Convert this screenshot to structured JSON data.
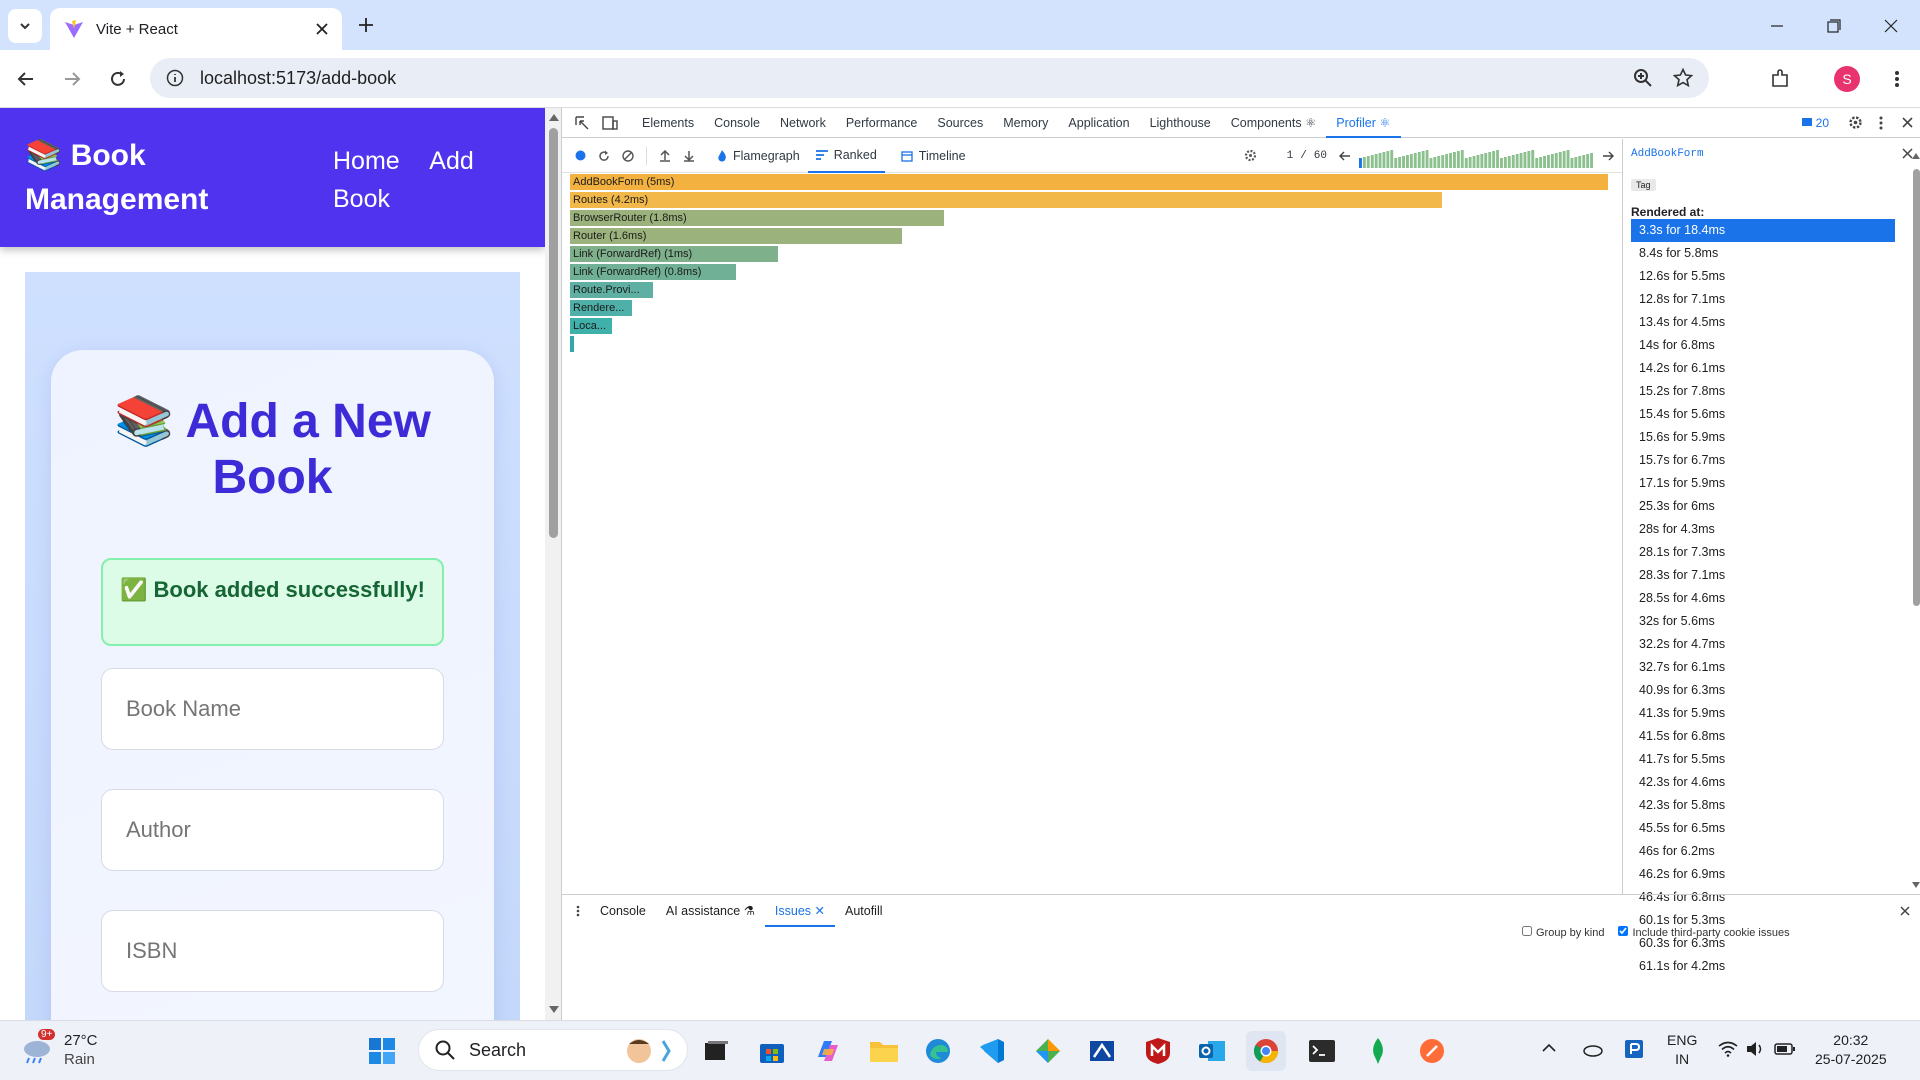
{
  "browser": {
    "tab_title": "Vite + React",
    "url": "localhost:5173/add-book",
    "profile_initial": "S",
    "accent": "#1a73e8"
  },
  "app": {
    "brand": "📚 Book Management",
    "nav_home": "Home",
    "nav_add": "Add Book",
    "card_title": "📚 Add a New Book",
    "alert": "✅ Book added successfully!",
    "placeholders": {
      "book_name": "Book Name",
      "author": "Author",
      "isbn": "ISBN"
    },
    "navbar_color": "#4f33ef"
  },
  "devtools": {
    "tabs": [
      "Elements",
      "Console",
      "Network",
      "Performance",
      "Sources",
      "Memory",
      "Application",
      "Lighthouse",
      "Components ⚛",
      "Profiler ⚛"
    ],
    "active_tab": "Profiler ⚛",
    "issues_count": "20",
    "profiler": {
      "flamegraph": "Flamegraph",
      "ranked": "Ranked",
      "timeline": "Timeline",
      "commit_index": "1",
      "commit_sep": "/",
      "commit_total": "60",
      "ranked_bars": [
        {
          "label": "AddBookForm (5ms)",
          "ms": 5,
          "color": "#f3b23f"
        },
        {
          "label": "Routes (4.2ms)",
          "ms": 4.2,
          "color": "#f2b94a"
        },
        {
          "label": "BrowserRouter (1.8ms)",
          "ms": 1.8,
          "color": "#9bb27c"
        },
        {
          "label": "Router (1.6ms)",
          "ms": 1.6,
          "color": "#9bb27c"
        },
        {
          "label": "Link (ForwardRef) (1ms)",
          "ms": 1,
          "color": "#7fb08c"
        },
        {
          "label": "Link (ForwardRef) (0.8ms)",
          "ms": 0.8,
          "color": "#6fb096"
        },
        {
          "label": "Route.Provi...",
          "ms": 0.4,
          "color": "#5fb0a2"
        },
        {
          "label": "Rendere...",
          "ms": 0.3,
          "color": "#4eb0a8"
        },
        {
          "label": "Loca...",
          "ms": 0.2,
          "color": "#3fb0aa"
        },
        {
          "label": "",
          "ms": 0.02,
          "color": "#32a8a8"
        }
      ],
      "sidebar": {
        "component": "AddBookForm",
        "tag": "Tag",
        "rendered_at_label": "Rendered at:",
        "renders": [
          "3.3s for 18.4ms",
          "8.4s for 5.8ms",
          "12.6s for 5.5ms",
          "12.8s for 7.1ms",
          "13.4s for 4.5ms",
          "14s for 6.8ms",
          "14.2s for 6.1ms",
          "15.2s for 7.8ms",
          "15.4s for 5.6ms",
          "15.6s for 5.9ms",
          "15.7s for 6.7ms",
          "17.1s for 5.9ms",
          "25.3s for 6ms",
          "28s for 4.3ms",
          "28.1s for 7.3ms",
          "28.3s for 7.1ms",
          "28.5s for 4.6ms",
          "32s for 5.6ms",
          "32.2s for 4.7ms",
          "32.7s for 6.1ms",
          "40.9s for 6.3ms",
          "41.3s for 5.9ms",
          "41.5s for 6.8ms",
          "41.7s for 5.5ms",
          "42.3s for 4.6ms",
          "42.3s for 5.8ms",
          "45.5s for 6.5ms",
          "46s for 6.2ms",
          "46.2s for 6.9ms",
          "46.4s for 6.8ms",
          "60.1s for 5.3ms",
          "60.3s for 6.3ms",
          "61.1s for 4.2ms"
        ]
      }
    },
    "drawer": {
      "tabs": [
        "Console",
        "AI assistance ⚗",
        "Issues ✕",
        "Autofill"
      ],
      "active": "Issues ✕",
      "group_by_kind": "Group by kind",
      "include_third_party": "Include third-party cookie issues"
    }
  },
  "taskbar": {
    "temp": "27°C",
    "weather": "Rain",
    "badge": "9+",
    "search_placeholder": "Search",
    "lang1": "ENG",
    "lang2": "IN",
    "time": "20:32",
    "date": "25-07-2025"
  }
}
